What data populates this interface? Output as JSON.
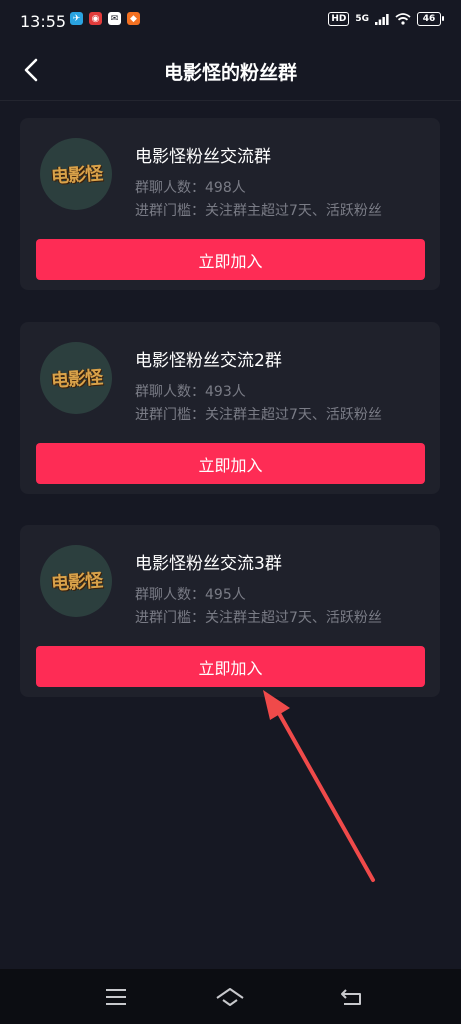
{
  "status_bar": {
    "time": "13:55",
    "hd": "HD",
    "network": "5G",
    "battery": "46",
    "notification_icons": [
      "telegram-icon",
      "weibo-icon",
      "mail-icon",
      "xiaohongshu-icon"
    ]
  },
  "header": {
    "title": "电影怪的粉丝群",
    "back_icon": "chevron-left-icon"
  },
  "groups": [
    {
      "avatar_text": "电影怪",
      "name": "电影怪粉丝交流群",
      "members": "群聊人数：498人",
      "threshold": "进群门槛：关注群主超过7天、活跃粉丝",
      "join_label": "立即加入"
    },
    {
      "avatar_text": "电影怪",
      "name": "电影怪粉丝交流2群",
      "members": "群聊人数：493人",
      "threshold": "进群门槛：关注群主超过7天、活跃粉丝",
      "join_label": "立即加入"
    },
    {
      "avatar_text": "电影怪",
      "name": "电影怪粉丝交流3群",
      "members": "群聊人数：495人",
      "threshold": "进群门槛：关注群主超过7天、活跃粉丝",
      "join_label": "立即加入"
    }
  ],
  "annotation": {
    "icon": "red-arrow-icon",
    "color": "#f04a4a"
  },
  "colors": {
    "background": "#161823",
    "card": "#1f212b",
    "accent": "#fe2c55",
    "muted_text": "#7a7c86"
  },
  "system_nav": {
    "icons": [
      "menu-icon",
      "home-icon",
      "back-icon"
    ]
  }
}
